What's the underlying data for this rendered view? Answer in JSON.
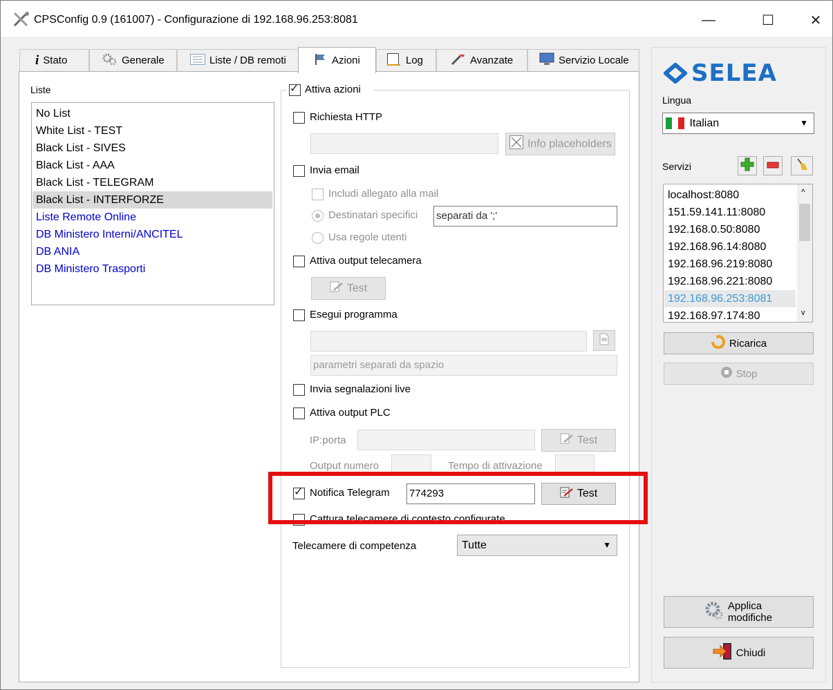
{
  "window": {
    "title": "CPSConfig 0.9 (161007) - Configurazione di 192.168.96.253:8081",
    "minimize": "—",
    "maximize": "☐",
    "close": "✕"
  },
  "tabs": [
    {
      "label": "Stato",
      "icon": "info-icon",
      "active": false
    },
    {
      "label": "Generale",
      "icon": "gears-icon",
      "active": false
    },
    {
      "label": "Liste / DB remoti",
      "icon": "list-icon",
      "active": false
    },
    {
      "label": "Azioni",
      "icon": "flag-icon",
      "active": true
    },
    {
      "label": "Log",
      "icon": "log-icon",
      "active": false
    },
    {
      "label": "Avanzate",
      "icon": "tools-icon",
      "active": false
    },
    {
      "label": "Servizio Locale",
      "icon": "monitor-icon",
      "active": false
    }
  ],
  "lists": {
    "label": "Liste",
    "items": [
      {
        "label": "No List",
        "link": false,
        "selected": false
      },
      {
        "label": "White List - TEST",
        "link": false,
        "selected": false
      },
      {
        "label": "Black List - SIVES",
        "link": false,
        "selected": false
      },
      {
        "label": "Black List - AAA",
        "link": false,
        "selected": false
      },
      {
        "label": "Black List - TELEGRAM",
        "link": false,
        "selected": false
      },
      {
        "label": "Black List - INTERFORZE",
        "link": false,
        "selected": true
      },
      {
        "label": "Liste Remote Online",
        "link": true,
        "selected": false
      },
      {
        "label": "DB Ministero Interni/ANCITEL",
        "link": true,
        "selected": false
      },
      {
        "label": "DB ANIA",
        "link": true,
        "selected": false
      },
      {
        "label": "DB Ministero Trasporti",
        "link": true,
        "selected": false
      }
    ]
  },
  "actions": {
    "enable_actions": {
      "label": "Attiva azioni",
      "checked": true
    },
    "http_request": {
      "label": "Richiesta HTTP",
      "checked": false,
      "url_value": ""
    },
    "info_placeholders": "Info placeholders",
    "send_email": {
      "label": "Invia email",
      "checked": false
    },
    "include_attachment": {
      "label": "Includi allegato alla mail",
      "checked": false
    },
    "specific_recipients": {
      "label": "Destinatari specifici",
      "checked": true
    },
    "recipients_value": "separati da ';'",
    "user_rules": {
      "label": "Usa regole utenti",
      "checked": false
    },
    "camera_output": {
      "label": "Attiva output telecamera",
      "checked": false
    },
    "camera_test": "Test",
    "run_program": {
      "label": "Esegui programma",
      "checked": false
    },
    "program_path": "",
    "program_params_placeholder": "parametri separati da spazio",
    "live_reports": {
      "label": "Invia segnalazioni live",
      "checked": false
    },
    "plc_output": {
      "label": "Attiva output PLC",
      "checked": false
    },
    "ip_port_label": "IP:porta",
    "ip_port_value": "",
    "plc_test": "Test",
    "output_number_label": "Output numero",
    "activation_time_label": "Tempo di attivazione",
    "telegram": {
      "label": "Notifica Telegram",
      "checked": true,
      "value": "774293",
      "test": "Test"
    },
    "capture_cameras": {
      "label": "Cattura telecamere di contesto configurate",
      "checked": false
    },
    "cameras_label": "Telecamere di competenza",
    "cameras_value": "Tutte"
  },
  "sidebar": {
    "logo_text": "SELEA",
    "language_label": "Lingua",
    "language_value": "Italian",
    "services_label": "Servizi",
    "services": [
      {
        "label": "localhost:8080",
        "selected": false
      },
      {
        "label": "151.59.141.11:8080",
        "selected": false
      },
      {
        "label": "192.168.0.50:8080",
        "selected": false
      },
      {
        "label": "192.168.96.14:8080",
        "selected": false
      },
      {
        "label": "192.168.96.219:8080",
        "selected": false
      },
      {
        "label": "192.168.96.221:8080",
        "selected": false
      },
      {
        "label": "192.168.96.253:8081",
        "selected": true
      },
      {
        "label": "192.168.97.174:80",
        "selected": false
      }
    ],
    "reload_button": "Ricarica",
    "stop_button": "Stop",
    "apply_button_line1": "Applica",
    "apply_button_line2": "modifiche",
    "close_button": "Chiudi"
  },
  "colors": {
    "link_blue": "#0000cc",
    "selected_row": "#d9d9d9",
    "highlight_red": "#e41010",
    "logo_blue": "#1d6fc4",
    "selected_service_text": "#3a9ad9"
  }
}
